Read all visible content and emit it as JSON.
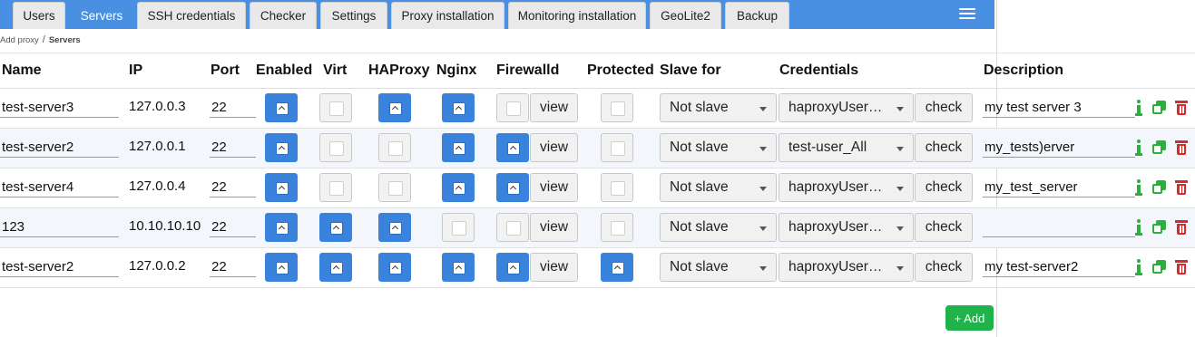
{
  "tabs": [
    {
      "label": "Users",
      "active": false
    },
    {
      "label": "Servers",
      "active": true
    },
    {
      "label": "SSH credentials",
      "active": false
    },
    {
      "label": "Checker",
      "active": false
    },
    {
      "label": "Settings",
      "active": false
    },
    {
      "label": "Proxy installation",
      "active": false
    },
    {
      "label": "Monitoring installation",
      "active": false
    },
    {
      "label": "GeoLite2",
      "active": false
    },
    {
      "label": "Backup",
      "active": false
    }
  ],
  "menu_icon": "hamburger-icon",
  "breadcrumb": {
    "parent": "Add proxy",
    "separator": "/",
    "current": "Servers"
  },
  "columns": {
    "name": "Name",
    "ip": "IP",
    "port": "Port",
    "enabled": "Enabled",
    "virt": "Virt",
    "haproxy": "HAProxy",
    "nginx": "Nginx",
    "firewalld": "Firewalld",
    "protected": "Protected",
    "slave_for": "Slave for",
    "credentials": "Credentials",
    "description": "Description"
  },
  "buttons": {
    "view": "view",
    "check": "check",
    "add": "+ Add"
  },
  "colors": {
    "accent": "#4a90e2",
    "checked": "#3a83dc",
    "add": "#21b34b",
    "delete": "#d52b2b",
    "info": "#2eae3f"
  },
  "rows": [
    {
      "name": "test-server3",
      "ip": "127.0.0.3",
      "port": "22",
      "enabled": true,
      "virt": false,
      "haproxy": true,
      "nginx": true,
      "firewalld": false,
      "protected": false,
      "slave_for": "Not slave",
      "credentials": "haproxyUser…",
      "description": "my test server 3"
    },
    {
      "name": "test-server2",
      "ip": "127.0.0.1",
      "port": "22",
      "enabled": true,
      "virt": false,
      "haproxy": false,
      "nginx": true,
      "firewalld": true,
      "protected": false,
      "slave_for": "Not slave",
      "credentials": "test-user_All",
      "description": "my_tests)erver"
    },
    {
      "name": "test-server4",
      "ip": "127.0.0.4",
      "port": "22",
      "enabled": true,
      "virt": false,
      "haproxy": false,
      "nginx": true,
      "firewalld": true,
      "protected": false,
      "slave_for": "Not slave",
      "credentials": "haproxyUser…",
      "description": "my_test_server"
    },
    {
      "name": "123",
      "ip": "10.10.10.10",
      "port": "22",
      "enabled": true,
      "virt": true,
      "haproxy": true,
      "nginx": false,
      "firewalld": false,
      "protected": false,
      "slave_for": "Not slave",
      "credentials": "haproxyUser…",
      "description": ""
    },
    {
      "name": "test-server2",
      "ip": "127.0.0.2",
      "port": "22",
      "enabled": true,
      "virt": true,
      "haproxy": true,
      "nginx": true,
      "firewalld": true,
      "protected": true,
      "slave_for": "Not slave",
      "credentials": "haproxyUser…",
      "description": "my test-server2"
    }
  ]
}
